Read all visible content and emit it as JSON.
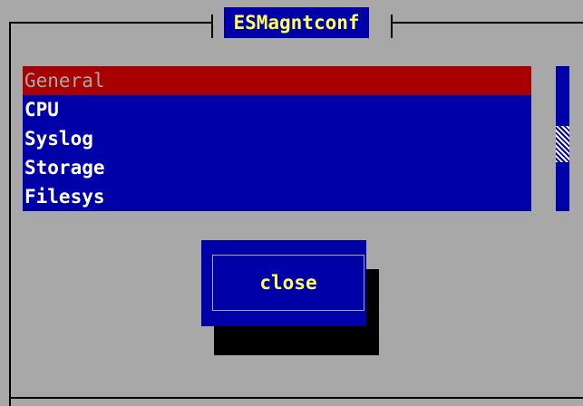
{
  "dialog": {
    "title": "ESMagntconf"
  },
  "list": {
    "items": [
      {
        "label": "General",
        "selected": true
      },
      {
        "label": "CPU",
        "selected": false
      },
      {
        "label": "Syslog",
        "selected": false
      },
      {
        "label": "Storage",
        "selected": false
      },
      {
        "label": "Filesys",
        "selected": false
      }
    ]
  },
  "buttons": {
    "close_label": "close"
  },
  "colors": {
    "background": "#a8a8a8",
    "list_bg": "#0000a8",
    "selected_bg": "#a80000",
    "title_text": "#ffff55"
  }
}
